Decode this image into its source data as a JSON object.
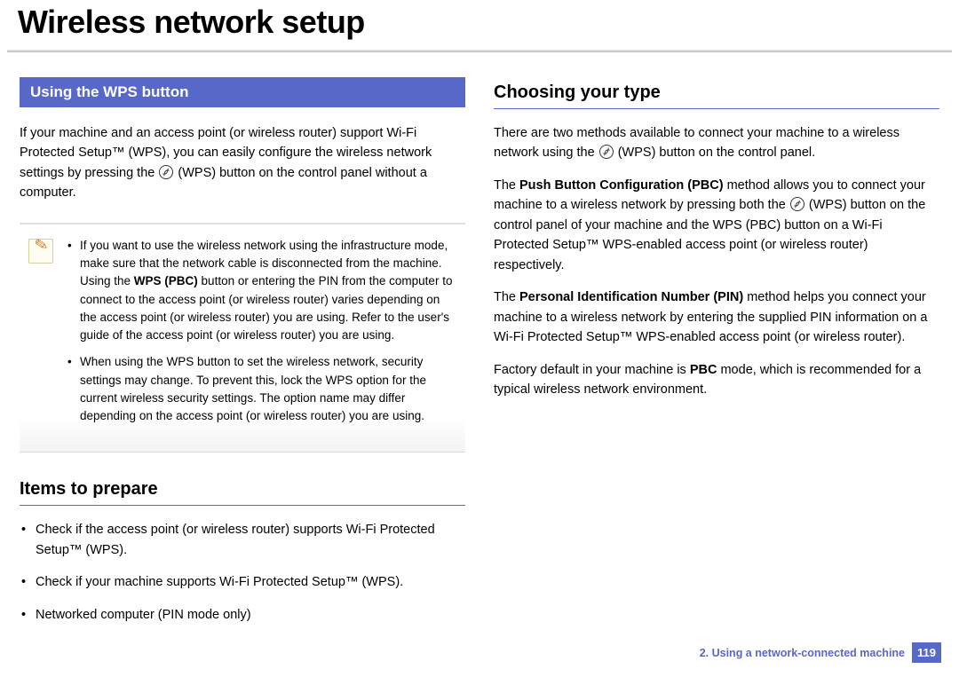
{
  "page_title": "Wireless network setup",
  "left": {
    "section_bar": "Using the WPS button",
    "intro_before": "If your machine and an access point (or wireless router) support Wi-Fi Protected Setup™ (WPS), you can easily configure the wireless network settings by pressing the ",
    "intro_after": " (WPS) button on the control panel without a computer.",
    "note": {
      "item1_before": "If you want to use the wireless network using the infrastructure mode, make sure that the network cable is disconnected from the machine. Using the ",
      "item1_bold": "WPS (PBC)",
      "item1_after": " button or entering the PIN from the computer to connect to the access point (or wireless router) varies depending on the access point (or wireless router) you are using. Refer to the user's guide of the access point (or wireless router) you are using.",
      "item2": "When using the WPS button to set the wireless network, security settings may change. To prevent this, lock the WPS option for the current wireless security settings. The option name may differ depending on the access point (or wireless router) you are using."
    },
    "items_heading": "Items to prepare",
    "items": [
      "Check if the access point (or wireless router) supports Wi-Fi Protected Setup™ (WPS).",
      "Check if your machine supports Wi-Fi Protected Setup™ (WPS).",
      "Networked computer (PIN mode only)"
    ]
  },
  "right": {
    "heading": "Choosing your type",
    "p1_before": "There are two methods available to connect your machine to a wireless network using the ",
    "p1_after": " (WPS) button on the control panel.",
    "p2_before": "The ",
    "p2_bold": "Push Button Configuration (PBC)",
    "p2_mid": " method allows you to connect your machine to a wireless network by pressing both the ",
    "p2_after": " (WPS) button on the control panel of your machine and the WPS (PBC) button on a Wi-Fi Protected Setup™ WPS-enabled access point (or wireless router) respectively.",
    "p3_before": "The ",
    "p3_bold": "Personal Identification Number (PIN)",
    "p3_after": " method helps you connect your machine to a wireless network by entering the supplied PIN information on a Wi-Fi Protected Setup™ WPS-enabled access point (or wireless router).",
    "p4_before": "Factory default in your machine is ",
    "p4_bold": "PBC",
    "p4_after": " mode, which is recommended for a typical wireless network environment."
  },
  "footer": {
    "chapter": "2.  Using a network-connected machine",
    "page": "119"
  }
}
